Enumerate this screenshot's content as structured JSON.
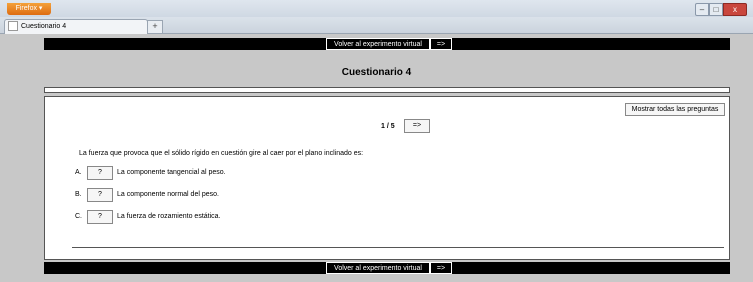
{
  "browser": {
    "menu_label": "Firefox ▾",
    "tab_title": "Cuestionario 4",
    "new_tab": "+",
    "minimize": "–",
    "maximize": "□",
    "close": "x"
  },
  "nav": {
    "back_label": "Volver al experimento virtual",
    "next_label": "=>"
  },
  "page": {
    "title": "Cuestionario 4",
    "show_all_label": "Mostrar todas las preguntas",
    "pager": "1 / 5",
    "pager_next": "=>"
  },
  "question": {
    "text": "La fuerza que provoca que el sólido rígido en cuestión gire al caer por el plano inclinado es:",
    "options": [
      {
        "letter": "A.",
        "button": "?",
        "text": "La componente tangencial al peso."
      },
      {
        "letter": "B.",
        "button": "?",
        "text": "La componente normal del peso."
      },
      {
        "letter": "C.",
        "button": "?",
        "text": "La fuerza de rozamiento estática."
      }
    ]
  }
}
